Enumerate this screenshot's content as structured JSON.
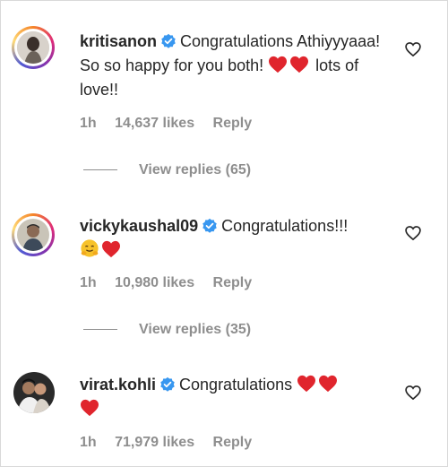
{
  "comments": [
    {
      "username": "kritisanon",
      "text_parts": [
        "Congratulations Athiyyyaaa! So so happy for you both! ",
        " lots of love!!"
      ],
      "time": "1h",
      "likes": "14,637 likes",
      "reply": "Reply",
      "view_replies": "View replies (65)"
    },
    {
      "username": "vickykaushal09",
      "text": "Congratulations!!!",
      "time": "1h",
      "likes": "10,980 likes",
      "reply": "Reply",
      "view_replies": "View replies (35)"
    },
    {
      "username": "virat.kohli",
      "text": "Congratulations",
      "time": "1h",
      "likes": "71,979 likes",
      "reply": "Reply"
    }
  ],
  "icons": {
    "verified_color": "#3897f0",
    "heart_color": "#e0252d"
  }
}
